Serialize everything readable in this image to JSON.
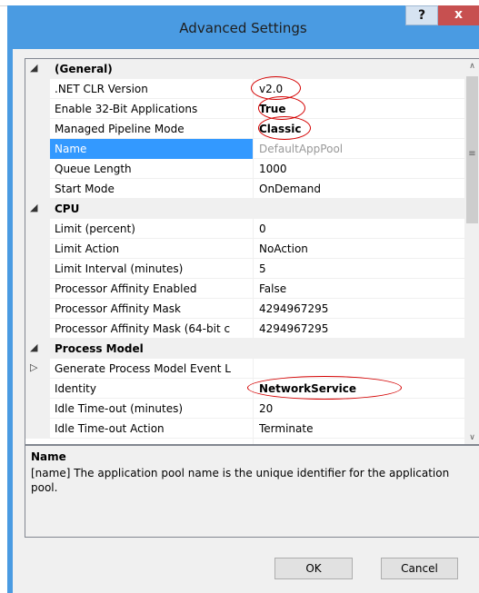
{
  "window": {
    "title": "Advanced Settings",
    "help_label": "?",
    "close_label": "x"
  },
  "grid": {
    "rows": [
      {
        "type": "cat",
        "expander": "◢",
        "name": "(General)"
      },
      {
        "type": "prop",
        "name": ".NET CLR Version",
        "value": "v2.0",
        "circled": true
      },
      {
        "type": "prop",
        "name": "Enable 32-Bit Applications",
        "value": "True",
        "bold": true,
        "circled": true
      },
      {
        "type": "prop",
        "name": "Managed Pipeline Mode",
        "value": "Classic",
        "bold": true,
        "circled": true
      },
      {
        "type": "prop",
        "name": "Name",
        "value": "DefaultAppPool",
        "selected": true
      },
      {
        "type": "prop",
        "name": "Queue Length",
        "value": "1000"
      },
      {
        "type": "prop",
        "name": "Start Mode",
        "value": "OnDemand"
      },
      {
        "type": "cat",
        "expander": "◢",
        "name": "CPU"
      },
      {
        "type": "prop",
        "name": "Limit (percent)",
        "value": "0"
      },
      {
        "type": "prop",
        "name": "Limit Action",
        "value": "NoAction"
      },
      {
        "type": "prop",
        "name": "Limit Interval (minutes)",
        "value": "5"
      },
      {
        "type": "prop",
        "name": "Processor Affinity Enabled",
        "value": "False"
      },
      {
        "type": "prop",
        "name": "Processor Affinity Mask",
        "value": "4294967295"
      },
      {
        "type": "prop",
        "name": "Processor Affinity Mask (64-bit c",
        "value": "4294967295"
      },
      {
        "type": "cat",
        "expander": "◢",
        "name": "Process Model"
      },
      {
        "type": "prop",
        "expander": "▷",
        "name": "Generate Process Model Event L",
        "value": ""
      },
      {
        "type": "prop",
        "name": "Identity",
        "value": "NetworkService",
        "bold": true,
        "circled": true
      },
      {
        "type": "prop",
        "name": "Idle Time-out (minutes)",
        "value": "20"
      },
      {
        "type": "prop",
        "name": "Idle Time-out Action",
        "value": "Terminate"
      }
    ],
    "scroll_up": "∧",
    "scroll_down": "∨",
    "scroll_grip": "≡"
  },
  "description": {
    "title": "Name",
    "text": "[name] The application pool name is the unique identifier for the application pool."
  },
  "buttons": {
    "ok": "OK",
    "cancel": "Cancel"
  },
  "colors": {
    "window_frame": "#4a9be2",
    "selection": "#3399ff",
    "annotation": "#d40000",
    "close_button": "#c75050"
  }
}
